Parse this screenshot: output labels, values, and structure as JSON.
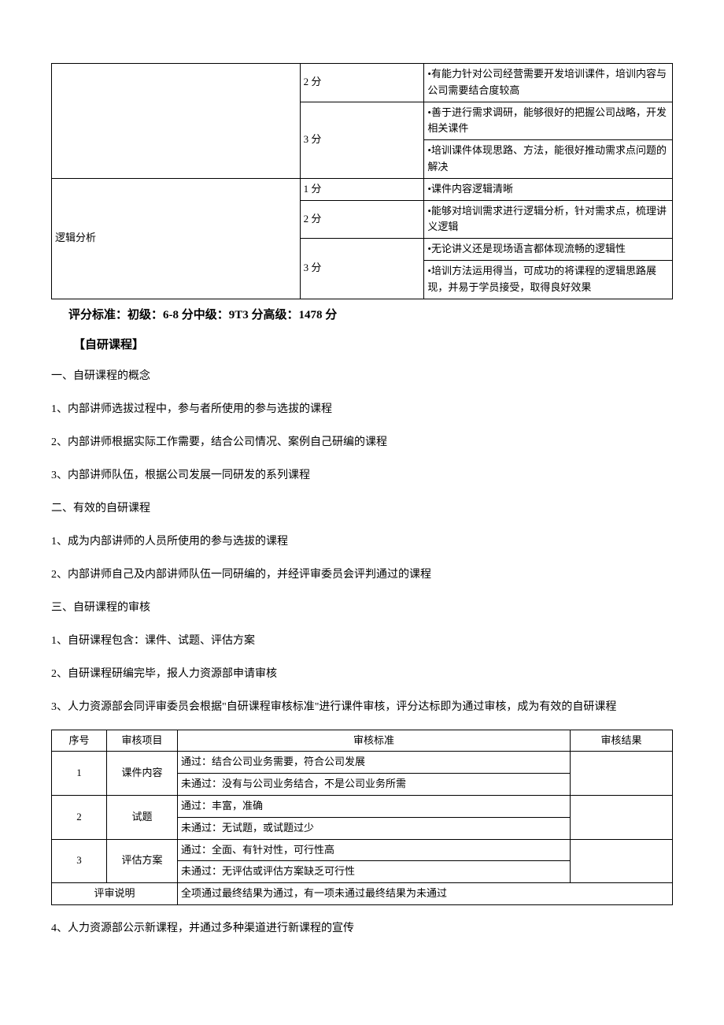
{
  "table1": {
    "rows": [
      {
        "cat": "",
        "score": "2 分",
        "desc": "•有能力针对公司经营需要开发培训课件，培训内容与公司需要结合度较高"
      },
      {
        "cat": "",
        "score": "3 分",
        "desc1": "•善于进行需求调研，能够很好的把握公司战略，开发相关课件",
        "desc2": "•培训课件体现思路、方法，能很好推动需求点问题的解决"
      },
      {
        "cat": "逻辑分析",
        "score": "1 分",
        "desc": "•课件内容逻辑清晰"
      },
      {
        "cat": "",
        "score": "2 分",
        "desc": "•能够对培训需求进行逻辑分析，针对需求点，梳理讲义逻辑"
      },
      {
        "cat": "",
        "score": "3 分",
        "desc1": "•无论讲义还是现场语言都体现流畅的逻辑性",
        "desc2": "•培训方法运用得当，可成功的将课程的逻辑思路展现，并易于学员接受，取得良好效果"
      }
    ]
  },
  "rating_standard": "评分标准：初级：6-8 分中级：9T3 分高级：1478 分",
  "section_header": "【自研课程】",
  "paragraphs": [
    "一、自研课程的概念",
    "1、内部讲师选拔过程中，参与者所使用的参与选拔的课程",
    "2、内部讲师根据实际工作需要，结合公司情况、案例自己研编的课程",
    "3、内部讲师队伍，根据公司发展一同研发的系列课程",
    "二、有效的自研课程",
    "1、成为内部讲师的人员所使用的参与选拔的课程",
    "2、内部讲师自己及内部讲师队伍一同研编的，并经评审委员会评判通过的课程",
    "三、自研课程的审核",
    "1、自研课程包含：课件、试题、评估方案",
    "2、自研课程研编完毕，报人力资源部申请审核",
    "3、人力资源部会同评审委员会根据\"自研课程审核标准\"进行课件审核，评分达标即为通过审核，成为有效的自研课程"
  ],
  "table2": {
    "header": {
      "seq": "序号",
      "item": "审核项目",
      "std": "审核标准",
      "res": "审核结果"
    },
    "rows": [
      {
        "seq": "1",
        "item": "课件内容",
        "line1": "通过：结合公司业务需要，符合公司发展",
        "line2": "未通过：没有与公司业务结合，不是公司业务所需"
      },
      {
        "seq": "2",
        "item": "试题",
        "line1": "通过：丰富，准确",
        "line2": "未通过：无试题，或试题过少"
      },
      {
        "seq": "3",
        "item": "评估方案",
        "line1": "通过：全面、有针对性，可行性高",
        "line2": "未通过：无评估或评估方案缺乏可行性"
      }
    ],
    "footer": {
      "label": "评审说明",
      "text": "全项通过最终结果为通过，有一项未通过最终结果为未通过"
    }
  },
  "final_para": "4、人力资源部公示新课程，并通过多种渠道进行新课程的宣传"
}
